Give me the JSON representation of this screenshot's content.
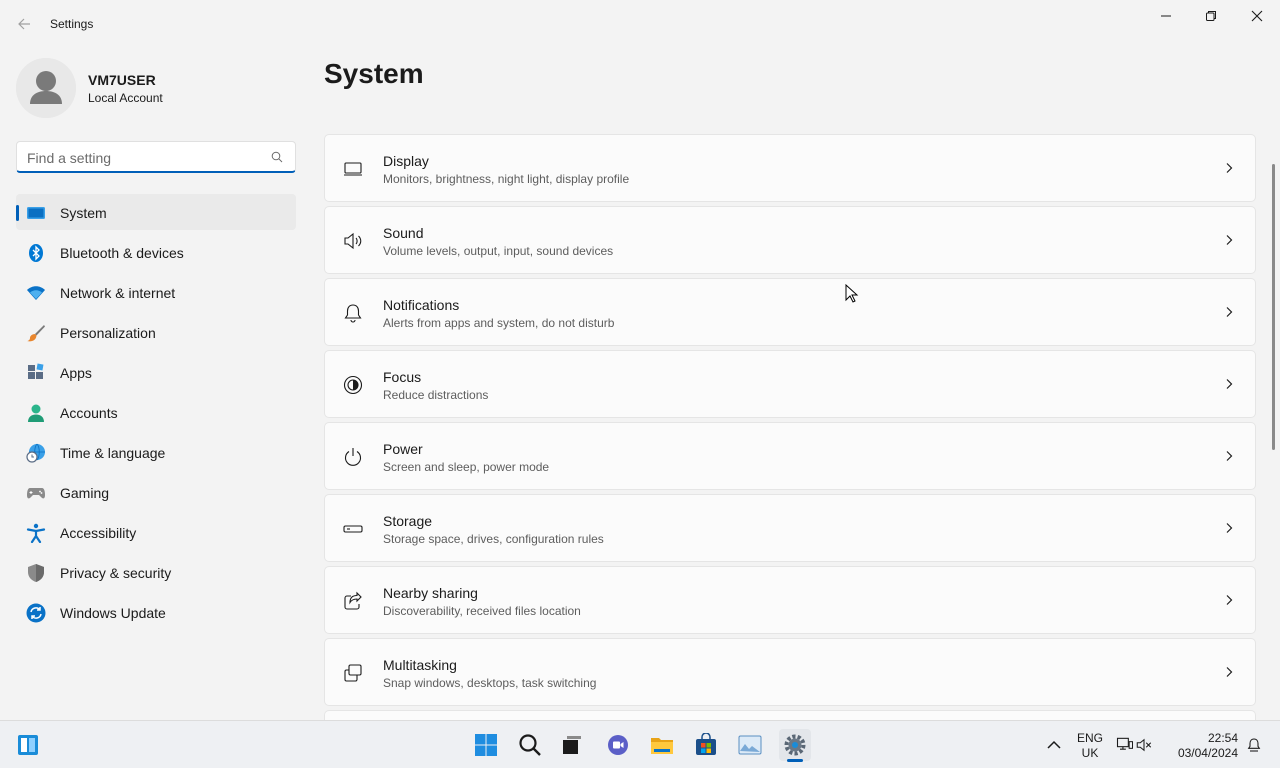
{
  "window": {
    "title": "Settings",
    "controls": [
      "minimize-icon",
      "restore-icon",
      "close-icon"
    ]
  },
  "profile": {
    "name": "VM7USER",
    "account_type": "Local Account"
  },
  "search": {
    "placeholder": "Find a setting",
    "value": ""
  },
  "nav": {
    "selected": "System",
    "items": [
      {
        "label": "System",
        "icon": "system-icon",
        "color": "#0078d4"
      },
      {
        "label": "Bluetooth & devices",
        "icon": "bluetooth-icon",
        "color": "#0078d4"
      },
      {
        "label": "Network & internet",
        "icon": "wifi-icon",
        "color": "#0078d4"
      },
      {
        "label": "Personalization",
        "icon": "paintbrush-icon",
        "color": "#d67a2b"
      },
      {
        "label": "Apps",
        "icon": "apps-icon",
        "color": "#4a6fa5"
      },
      {
        "label": "Accounts",
        "icon": "accounts-icon",
        "color": "#2bb58b"
      },
      {
        "label": "Time & language",
        "icon": "globe-clock-icon",
        "color": "#0078d4"
      },
      {
        "label": "Gaming",
        "icon": "gamepad-icon",
        "color": "#7a7a7a"
      },
      {
        "label": "Accessibility",
        "icon": "accessibility-icon",
        "color": "#0a72c7"
      },
      {
        "label": "Privacy & security",
        "icon": "shield-icon",
        "color": "#7a7a7a"
      },
      {
        "label": "Windows Update",
        "icon": "update-icon",
        "color": "#0078d4"
      }
    ]
  },
  "main": {
    "title": "System",
    "cards": [
      {
        "title": "Display",
        "subtitle": "Monitors, brightness, night light, display profile",
        "icon": "display-icon"
      },
      {
        "title": "Sound",
        "subtitle": "Volume levels, output, input, sound devices",
        "icon": "speaker-icon"
      },
      {
        "title": "Notifications",
        "subtitle": "Alerts from apps and system, do not disturb",
        "icon": "bell-icon"
      },
      {
        "title": "Focus",
        "subtitle": "Reduce distractions",
        "icon": "focus-icon"
      },
      {
        "title": "Power",
        "subtitle": "Screen and sleep, power mode",
        "icon": "power-icon"
      },
      {
        "title": "Storage",
        "subtitle": "Storage space, drives, configuration rules",
        "icon": "storage-icon"
      },
      {
        "title": "Nearby sharing",
        "subtitle": "Discoverability, received files location",
        "icon": "share-icon"
      },
      {
        "title": "Multitasking",
        "subtitle": "Snap windows, desktops, task switching",
        "icon": "multitasking-icon"
      }
    ]
  },
  "taskbar": {
    "apps": [
      "widgets-icon",
      "start-icon",
      "search-icon",
      "task-view-icon",
      "chat-icon",
      "file-explorer-icon",
      "store-icon",
      "photos-icon",
      "settings-icon"
    ],
    "active_app": "settings-icon",
    "tray": {
      "language_line1": "ENG",
      "language_line2": "UK",
      "time": "22:54",
      "date": "03/04/2024"
    }
  },
  "colors": {
    "accent": "#005fb8",
    "background": "#f3f3f3",
    "card": "#fbfbfb"
  }
}
